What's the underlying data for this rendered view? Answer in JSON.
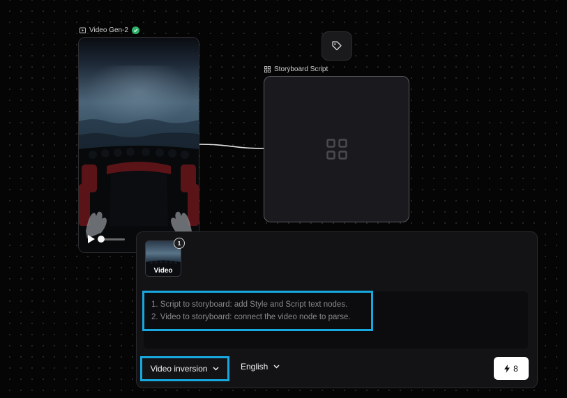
{
  "video_node": {
    "title": "Video Gen-2",
    "status": "complete"
  },
  "storyboard_node": {
    "title": "Storyboard Script"
  },
  "panel": {
    "attachment": {
      "label": "Video",
      "count": "1"
    },
    "prompt_placeholder_lines": [
      "1. Script to storyboard: add Style and Script text nodes.",
      "2. Video to storyboard: connect the video node to parse."
    ],
    "mode": "Video inversion",
    "language": "English",
    "credits": "8"
  },
  "colors": {
    "highlight": "#18a8e0",
    "success": "#2db36a",
    "background": "#050505"
  },
  "icons": {
    "video_title": "video-icon",
    "storyboard_title": "grid-icon",
    "tag_button": "tag-icon",
    "story_placeholder": "grid-icon",
    "status": "check-icon",
    "credit": "lightning-icon",
    "dropdown": "chevron-down-icon"
  }
}
